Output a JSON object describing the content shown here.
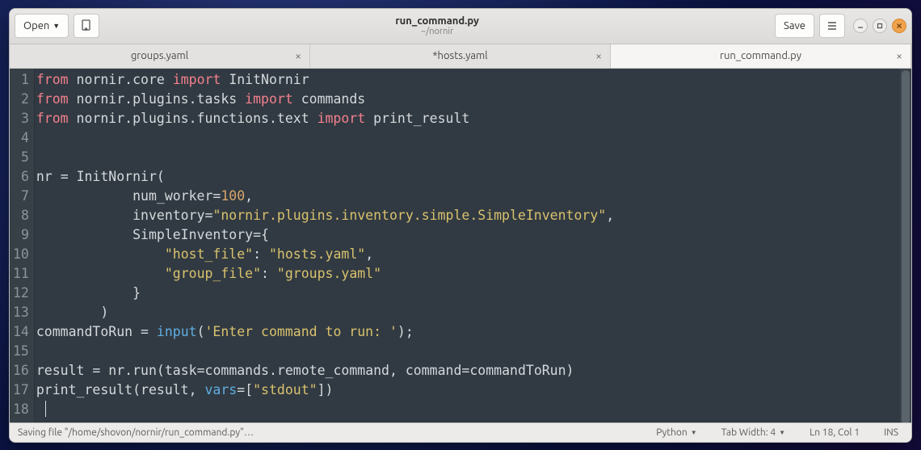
{
  "window": {
    "title": "run_command.py",
    "subtitle": "~/nornir"
  },
  "toolbar": {
    "open_label": "Open",
    "save_label": "Save"
  },
  "tabs": [
    {
      "label": "groups.yaml",
      "active": false
    },
    {
      "label": "*hosts.yaml",
      "active": false
    },
    {
      "label": "run_command.py",
      "active": true
    }
  ],
  "editor": {
    "language": "Python",
    "line_count": 18,
    "tokens": [
      [
        {
          "t": "from ",
          "c": "kw"
        },
        {
          "t": "nornir.core ",
          "c": "id"
        },
        {
          "t": "import ",
          "c": "kw"
        },
        {
          "t": "InitNornir",
          "c": "id"
        }
      ],
      [
        {
          "t": "from ",
          "c": "kw"
        },
        {
          "t": "nornir.plugins.tasks ",
          "c": "id"
        },
        {
          "t": "import ",
          "c": "kw"
        },
        {
          "t": "commands",
          "c": "id"
        }
      ],
      [
        {
          "t": "from ",
          "c": "kw"
        },
        {
          "t": "nornir.plugins.functions.text ",
          "c": "id"
        },
        {
          "t": "import ",
          "c": "kw"
        },
        {
          "t": "print_result",
          "c": "id"
        }
      ],
      [],
      [],
      [
        {
          "t": "nr ",
          "c": "id"
        },
        {
          "t": "= ",
          "c": "op"
        },
        {
          "t": "InitNornir",
          "c": "id"
        },
        {
          "t": "(",
          "c": "op"
        }
      ],
      [
        {
          "t": "            num_worker",
          "c": "id"
        },
        {
          "t": "=",
          "c": "op"
        },
        {
          "t": "100",
          "c": "num"
        },
        {
          "t": ",",
          "c": "op"
        }
      ],
      [
        {
          "t": "            inventory",
          "c": "id"
        },
        {
          "t": "=",
          "c": "op"
        },
        {
          "t": "\"nornir.plugins.inventory.simple.SimpleInventory\"",
          "c": "str"
        },
        {
          "t": ",",
          "c": "op"
        }
      ],
      [
        {
          "t": "            SimpleInventory",
          "c": "id"
        },
        {
          "t": "=",
          "c": "op"
        },
        {
          "t": "{",
          "c": "op"
        }
      ],
      [
        {
          "t": "                ",
          "c": "op"
        },
        {
          "t": "\"host_file\"",
          "c": "str"
        },
        {
          "t": ": ",
          "c": "op"
        },
        {
          "t": "\"hosts.yaml\"",
          "c": "str"
        },
        {
          "t": ",",
          "c": "op"
        }
      ],
      [
        {
          "t": "                ",
          "c": "op"
        },
        {
          "t": "\"group_file\"",
          "c": "str"
        },
        {
          "t": ": ",
          "c": "op"
        },
        {
          "t": "\"groups.yaml\"",
          "c": "str"
        }
      ],
      [
        {
          "t": "            }",
          "c": "op"
        }
      ],
      [
        {
          "t": "        )",
          "c": "op"
        }
      ],
      [
        {
          "t": "commandToRun ",
          "c": "id"
        },
        {
          "t": "= ",
          "c": "op"
        },
        {
          "t": "input",
          "c": "fn"
        },
        {
          "t": "(",
          "c": "op"
        },
        {
          "t": "'Enter command to run: '",
          "c": "str"
        },
        {
          "t": ");",
          "c": "op"
        }
      ],
      [],
      [
        {
          "t": "result ",
          "c": "id"
        },
        {
          "t": "= ",
          "c": "op"
        },
        {
          "t": "nr.run(task",
          "c": "id"
        },
        {
          "t": "=",
          "c": "op"
        },
        {
          "t": "commands.remote_command, command",
          "c": "id"
        },
        {
          "t": "=",
          "c": "op"
        },
        {
          "t": "commandToRun)",
          "c": "id"
        }
      ],
      [
        {
          "t": "print_result(result, ",
          "c": "id"
        },
        {
          "t": "vars",
          "c": "fn"
        },
        {
          "t": "=",
          "c": "op"
        },
        {
          "t": "[",
          "c": "op"
        },
        {
          "t": "\"stdout\"",
          "c": "str"
        },
        {
          "t": "])",
          "c": "op"
        }
      ],
      []
    ]
  },
  "statusbar": {
    "message": "Saving file \"/home/shovon/nornir/run_command.py\"…",
    "language": "Python",
    "tab_width_label": "Tab Width: 4",
    "cursor_pos": "Ln 18, Col 1",
    "insert_mode": "INS"
  }
}
